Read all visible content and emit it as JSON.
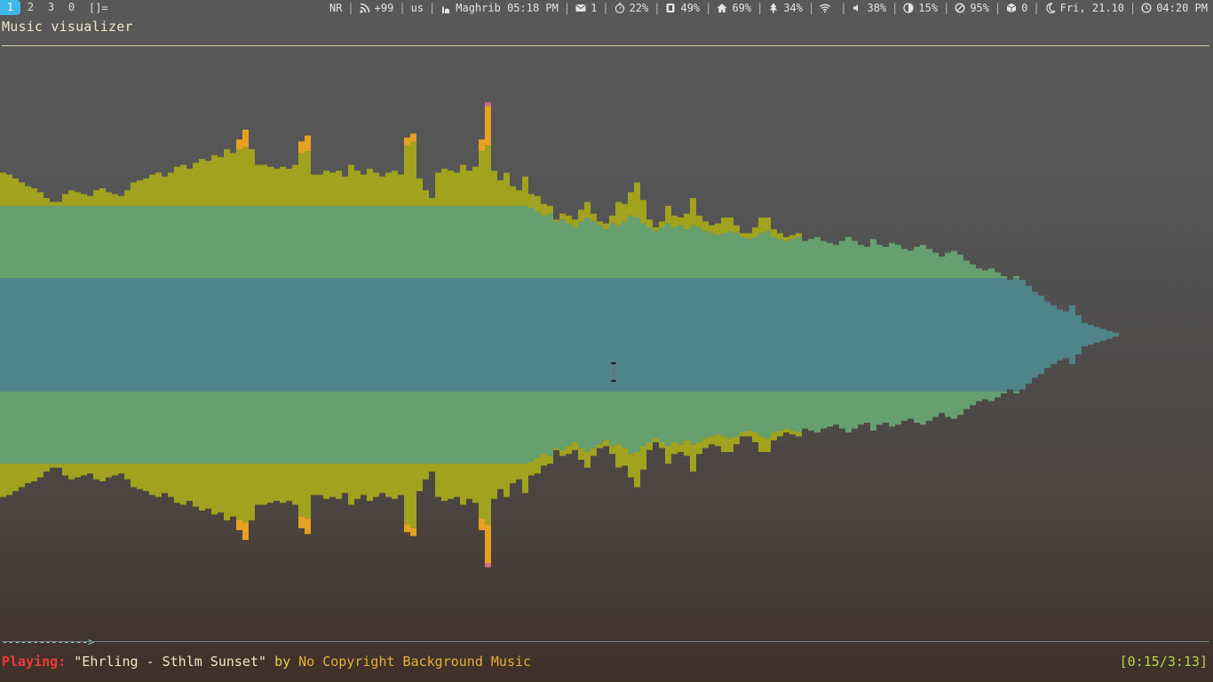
{
  "workspaces": {
    "items": [
      {
        "label": "1",
        "active": true
      },
      {
        "label": "2",
        "active": false
      },
      {
        "label": "3",
        "active": false
      },
      {
        "label": "0",
        "active": false
      }
    ],
    "layout": "[]="
  },
  "status": {
    "mode": "NR",
    "rss": "+99",
    "keyboard": "us",
    "prayer": "Maghrib 05:18 PM",
    "mail": "1",
    "cpu": "22%",
    "memory": "49%",
    "home": "69%",
    "root": "34%",
    "volume": "38%",
    "brightness": "15%",
    "battery": "95%",
    "packages": "0",
    "date": "Fri, 21.10",
    "time": "04:20 PM"
  },
  "icons": {
    "mode": "none",
    "rss": "rss-icon",
    "keyboard": "none",
    "prayer": "mosque-icon",
    "mail": "mail-icon",
    "cpu": "stopwatch-icon",
    "memory": "memory-icon",
    "home": "home-icon",
    "root": "tree-icon",
    "wifi": "wifi-icon",
    "volume": "speaker-icon",
    "brightness": "contrast-icon",
    "battery": "blocked-icon",
    "packages": "package-icon",
    "date": "moon-icon",
    "time": "clock-icon"
  },
  "window": {
    "title": "Music visualizer"
  },
  "visualizer": {
    "colors": {
      "inner": "#4f8589",
      "mid": "#67a06f",
      "outer": "#a1a21e",
      "peak": "#e6a122",
      "top": "#d36b88"
    },
    "bars": [
      [
        0.66,
        0.17,
        0,
        0
      ],
      [
        0.66,
        0.16,
        0,
        0
      ],
      [
        0.66,
        0.14,
        0,
        0
      ],
      [
        0.66,
        0.12,
        0,
        0
      ],
      [
        0.66,
        0.1,
        0,
        0
      ],
      [
        0.66,
        0.09,
        0,
        0
      ],
      [
        0.66,
        0.07,
        0,
        0
      ],
      [
        0.66,
        0.04,
        0,
        0
      ],
      [
        0.66,
        0.02,
        0,
        0
      ],
      [
        0.66,
        0.02,
        0,
        0
      ],
      [
        0.66,
        0.06,
        0,
        0
      ],
      [
        0.66,
        0.08,
        0,
        0
      ],
      [
        0.66,
        0.07,
        0,
        0
      ],
      [
        0.66,
        0.06,
        0,
        0
      ],
      [
        0.66,
        0.05,
        0,
        0
      ],
      [
        0.66,
        0.08,
        0,
        0
      ],
      [
        0.66,
        0.09,
        0,
        0
      ],
      [
        0.66,
        0.07,
        0,
        0
      ],
      [
        0.66,
        0.06,
        0,
        0
      ],
      [
        0.66,
        0.05,
        0,
        0
      ],
      [
        0.66,
        0.08,
        0,
        0
      ],
      [
        0.66,
        0.12,
        0,
        0
      ],
      [
        0.66,
        0.13,
        0,
        0
      ],
      [
        0.66,
        0.14,
        0,
        0
      ],
      [
        0.66,
        0.16,
        0,
        0
      ],
      [
        0.66,
        0.17,
        0,
        0
      ],
      [
        0.66,
        0.15,
        0,
        0
      ],
      [
        0.66,
        0.17,
        0,
        0
      ],
      [
        0.66,
        0.2,
        0,
        0
      ],
      [
        0.66,
        0.21,
        0,
        0
      ],
      [
        0.66,
        0.19,
        0,
        0
      ],
      [
        0.66,
        0.22,
        0,
        0
      ],
      [
        0.66,
        0.24,
        0,
        0
      ],
      [
        0.66,
        0.23,
        0,
        0
      ],
      [
        0.66,
        0.26,
        0,
        0
      ],
      [
        0.66,
        0.25,
        0,
        0
      ],
      [
        0.66,
        0.29,
        0,
        0
      ],
      [
        0.66,
        0.27,
        0,
        0
      ],
      [
        0.66,
        0.29,
        0.05,
        0
      ],
      [
        0.66,
        0.3,
        0.09,
        0
      ],
      [
        0.66,
        0.29,
        0,
        0
      ],
      [
        0.66,
        0.21,
        0,
        0
      ],
      [
        0.66,
        0.21,
        0,
        0
      ],
      [
        0.66,
        0.2,
        0,
        0
      ],
      [
        0.66,
        0.19,
        0,
        0
      ],
      [
        0.66,
        0.2,
        0,
        0
      ],
      [
        0.66,
        0.19,
        0,
        0
      ],
      [
        0.66,
        0.21,
        0,
        0
      ],
      [
        0.66,
        0.27,
        0.06,
        0
      ],
      [
        0.66,
        0.28,
        0.08,
        0
      ],
      [
        0.66,
        0.16,
        0,
        0
      ],
      [
        0.66,
        0.16,
        0,
        0
      ],
      [
        0.66,
        0.18,
        0,
        0
      ],
      [
        0.66,
        0.17,
        0,
        0
      ],
      [
        0.66,
        0.18,
        0,
        0
      ],
      [
        0.66,
        0.15,
        0,
        0
      ],
      [
        0.66,
        0.21,
        0,
        0
      ],
      [
        0.66,
        0.18,
        0,
        0
      ],
      [
        0.66,
        0.16,
        0,
        0
      ],
      [
        0.66,
        0.19,
        0,
        0
      ],
      [
        0.66,
        0.17,
        0,
        0
      ],
      [
        0.66,
        0.15,
        0,
        0
      ],
      [
        0.66,
        0.17,
        0,
        0
      ],
      [
        0.66,
        0.18,
        0,
        0
      ],
      [
        0.66,
        0.16,
        0,
        0
      ],
      [
        0.66,
        0.31,
        0.04,
        0
      ],
      [
        0.66,
        0.33,
        0.04,
        0
      ],
      [
        0.66,
        0.14,
        0,
        0
      ],
      [
        0.66,
        0.08,
        0,
        0
      ],
      [
        0.66,
        0.04,
        0,
        0
      ],
      [
        0.66,
        0.17,
        0,
        0
      ],
      [
        0.66,
        0.19,
        0,
        0
      ],
      [
        0.66,
        0.18,
        0,
        0
      ],
      [
        0.66,
        0.17,
        0,
        0
      ],
      [
        0.66,
        0.21,
        0,
        0
      ],
      [
        0.66,
        0.18,
        0,
        0
      ],
      [
        0.66,
        0.2,
        0,
        0
      ],
      [
        0.66,
        0.28,
        0.06,
        0
      ],
      [
        0.66,
        0.31,
        0.2,
        0.02
      ],
      [
        0.66,
        0.18,
        0,
        0
      ],
      [
        0.66,
        0.13,
        0,
        0
      ],
      [
        0.66,
        0.17,
        0,
        0
      ],
      [
        0.66,
        0.1,
        0,
        0
      ],
      [
        0.66,
        0.08,
        0,
        0
      ],
      [
        0.66,
        0.15,
        0,
        0
      ],
      [
        0.65,
        0.07,
        0,
        0
      ],
      [
        0.63,
        0.08,
        0,
        0
      ],
      [
        0.61,
        0.06,
        0,
        0
      ],
      [
        0.62,
        0.04,
        0,
        0
      ],
      [
        0.58,
        0.01,
        0,
        0
      ],
      [
        0.59,
        0.03,
        0,
        0
      ],
      [
        0.57,
        0.04,
        0,
        0
      ],
      [
        0.55,
        0.04,
        0,
        0
      ],
      [
        0.58,
        0.06,
        0,
        0
      ],
      [
        0.6,
        0.08,
        0,
        0
      ],
      [
        0.58,
        0.04,
        0,
        0
      ],
      [
        0.56,
        0.02,
        0,
        0
      ],
      [
        0.54,
        0.03,
        0,
        0
      ],
      [
        0.57,
        0.04,
        0,
        0
      ],
      [
        0.56,
        0.12,
        0,
        0
      ],
      [
        0.58,
        0.09,
        0,
        0
      ],
      [
        0.61,
        0.12,
        0,
        0
      ],
      [
        0.6,
        0.18,
        0,
        0
      ],
      [
        0.57,
        0.12,
        0,
        0
      ],
      [
        0.55,
        0.04,
        0,
        0
      ],
      [
        0.53,
        0.02,
        0,
        0
      ],
      [
        0.55,
        0.03,
        0,
        0
      ],
      [
        0.57,
        0.09,
        0,
        0
      ],
      [
        0.55,
        0.06,
        0,
        0
      ],
      [
        0.56,
        0.04,
        0,
        0
      ],
      [
        0.54,
        0.08,
        0,
        0
      ],
      [
        0.56,
        0.14,
        0,
        0
      ],
      [
        0.55,
        0.06,
        0,
        0
      ],
      [
        0.53,
        0.05,
        0,
        0
      ],
      [
        0.52,
        0.04,
        0,
        0
      ],
      [
        0.51,
        0.06,
        0,
        0
      ],
      [
        0.52,
        0.08,
        0,
        0
      ],
      [
        0.53,
        0.07,
        0,
        0
      ],
      [
        0.52,
        0.04,
        0,
        0
      ],
      [
        0.5,
        0.02,
        0,
        0
      ],
      [
        0.49,
        0.03,
        0,
        0
      ],
      [
        0.5,
        0.05,
        0,
        0
      ],
      [
        0.52,
        0.08,
        0,
        0
      ],
      [
        0.53,
        0.07,
        0,
        0
      ],
      [
        0.5,
        0.04,
        0,
        0
      ],
      [
        0.49,
        0.03,
        0,
        0
      ],
      [
        0.48,
        0.02,
        0,
        0
      ],
      [
        0.49,
        0.02,
        0,
        0
      ],
      [
        0.5,
        0.02,
        0,
        0
      ],
      [
        0.48,
        0,
        0,
        0
      ],
      [
        0.49,
        0,
        0,
        0
      ],
      [
        0.5,
        0,
        0,
        0
      ],
      [
        0.48,
        0,
        0,
        0
      ],
      [
        0.47,
        0,
        0,
        0
      ],
      [
        0.46,
        0,
        0,
        0
      ],
      [
        0.48,
        0,
        0,
        0
      ],
      [
        0.5,
        0,
        0,
        0
      ],
      [
        0.48,
        0,
        0,
        0
      ],
      [
        0.46,
        0,
        0,
        0
      ],
      [
        0.45,
        0,
        0,
        0
      ],
      [
        0.49,
        0,
        0,
        0
      ],
      [
        0.46,
        0,
        0,
        0
      ],
      [
        0.45,
        0,
        0,
        0
      ],
      [
        0.47,
        0,
        0,
        0
      ],
      [
        0.46,
        0,
        0,
        0
      ],
      [
        0.44,
        0,
        0,
        0
      ],
      [
        0.43,
        0,
        0,
        0
      ],
      [
        0.45,
        0,
        0,
        0
      ],
      [
        0.46,
        0,
        0,
        0
      ],
      [
        0.44,
        0,
        0,
        0
      ],
      [
        0.42,
        0,
        0,
        0
      ],
      [
        0.4,
        0,
        0,
        0
      ],
      [
        0.42,
        0,
        0,
        0
      ],
      [
        0.43,
        0,
        0,
        0
      ],
      [
        0.41,
        0,
        0,
        0
      ],
      [
        0.38,
        0,
        0,
        0
      ],
      [
        0.36,
        0,
        0,
        0
      ],
      [
        0.34,
        0,
        0,
        0
      ],
      [
        0.33,
        0,
        0,
        0
      ],
      [
        0.34,
        0,
        0,
        0
      ],
      [
        0.32,
        0,
        0,
        0
      ],
      [
        0.3,
        0,
        0,
        0
      ],
      [
        0.28,
        0,
        0,
        0
      ],
      [
        0.3,
        0,
        0,
        0
      ],
      [
        0.28,
        0,
        0,
        0
      ],
      [
        0.25,
        0,
        0,
        0
      ],
      [
        0.22,
        0,
        0,
        0
      ],
      [
        0.2,
        0,
        0,
        0
      ],
      [
        0.17,
        0,
        0,
        0
      ],
      [
        0.15,
        0,
        0,
        0
      ],
      [
        0.13,
        0,
        0,
        0
      ],
      [
        0.12,
        0,
        0,
        0
      ],
      [
        0.15,
        0,
        0,
        0
      ],
      [
        0.1,
        0,
        0,
        0
      ],
      [
        0.06,
        0,
        0,
        0
      ],
      [
        0.05,
        0,
        0,
        0
      ],
      [
        0.04,
        0,
        0,
        0
      ],
      [
        0.03,
        0,
        0,
        0
      ],
      [
        0.02,
        0,
        0,
        0
      ],
      [
        0.01,
        0,
        0,
        0
      ]
    ]
  },
  "progress": {
    "bar": "-------------->"
  },
  "now_playing": {
    "label": "Playing:",
    "track": "\"Ehrling - Sthlm Sunset\"",
    "by": "by",
    "artist": "No Copyright Background Music",
    "time": "[0:15/3:13]"
  }
}
